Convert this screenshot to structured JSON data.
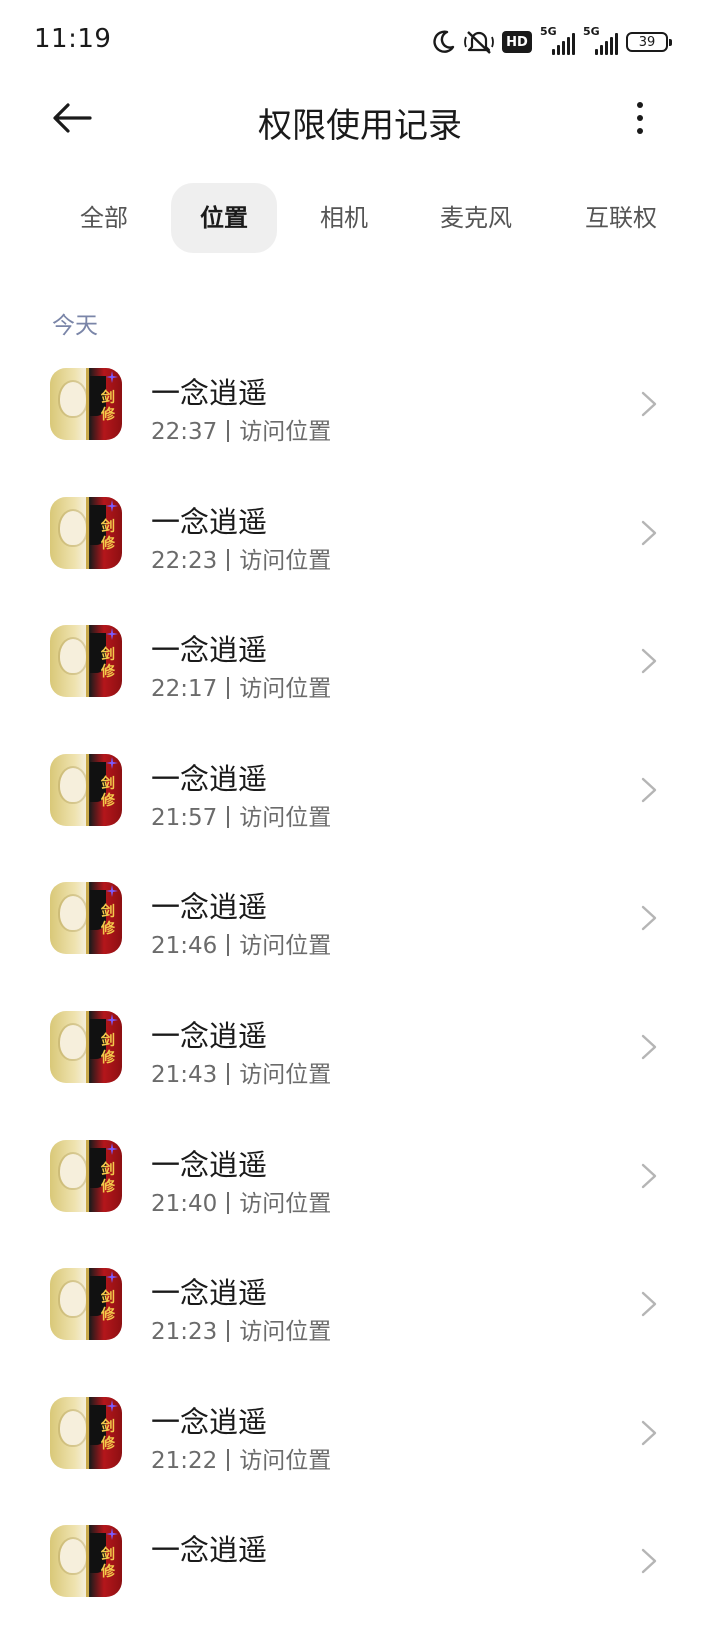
{
  "status_bar": {
    "time": "11:19",
    "network_1": "5G",
    "network_2": "5G",
    "hd_label": "HD",
    "battery": "39",
    "icons": [
      "moon-icon",
      "mute-icon",
      "hd-icon",
      "signal-icon",
      "signal-icon",
      "battery-icon"
    ]
  },
  "header": {
    "title": "权限使用记录",
    "back_icon": "back-arrow-icon",
    "more_icon": "more-vertical-icon"
  },
  "tabs": [
    {
      "label": "全部",
      "active": false
    },
    {
      "label": "位置",
      "active": true
    },
    {
      "label": "相机",
      "active": false
    },
    {
      "label": "麦克风",
      "active": false
    },
    {
      "label": "互联权",
      "active": false
    }
  ],
  "section": {
    "label": "今天"
  },
  "records": [
    {
      "app": "一念逍遥",
      "time": "22:37",
      "action": "访问位置"
    },
    {
      "app": "一念逍遥",
      "time": "22:23",
      "action": "访问位置"
    },
    {
      "app": "一念逍遥",
      "time": "22:17",
      "action": "访问位置"
    },
    {
      "app": "一念逍遥",
      "time": "21:57",
      "action": "访问位置"
    },
    {
      "app": "一念逍遥",
      "time": "21:46",
      "action": "访问位置"
    },
    {
      "app": "一念逍遥",
      "time": "21:43",
      "action": "访问位置"
    },
    {
      "app": "一念逍遥",
      "time": "21:40",
      "action": "访问位置"
    },
    {
      "app": "一念逍遥",
      "time": "21:23",
      "action": "访问位置"
    },
    {
      "app": "一念逍遥",
      "time": "21:22",
      "action": "访问位置"
    },
    {
      "app": "一念逍遥",
      "time": "",
      "action": ""
    }
  ],
  "colors": {
    "accent_section": "#7a85a8",
    "active_tab_bg": "#efefef",
    "text_primary": "#1a1a1a",
    "text_secondary": "#6b6b6b"
  }
}
